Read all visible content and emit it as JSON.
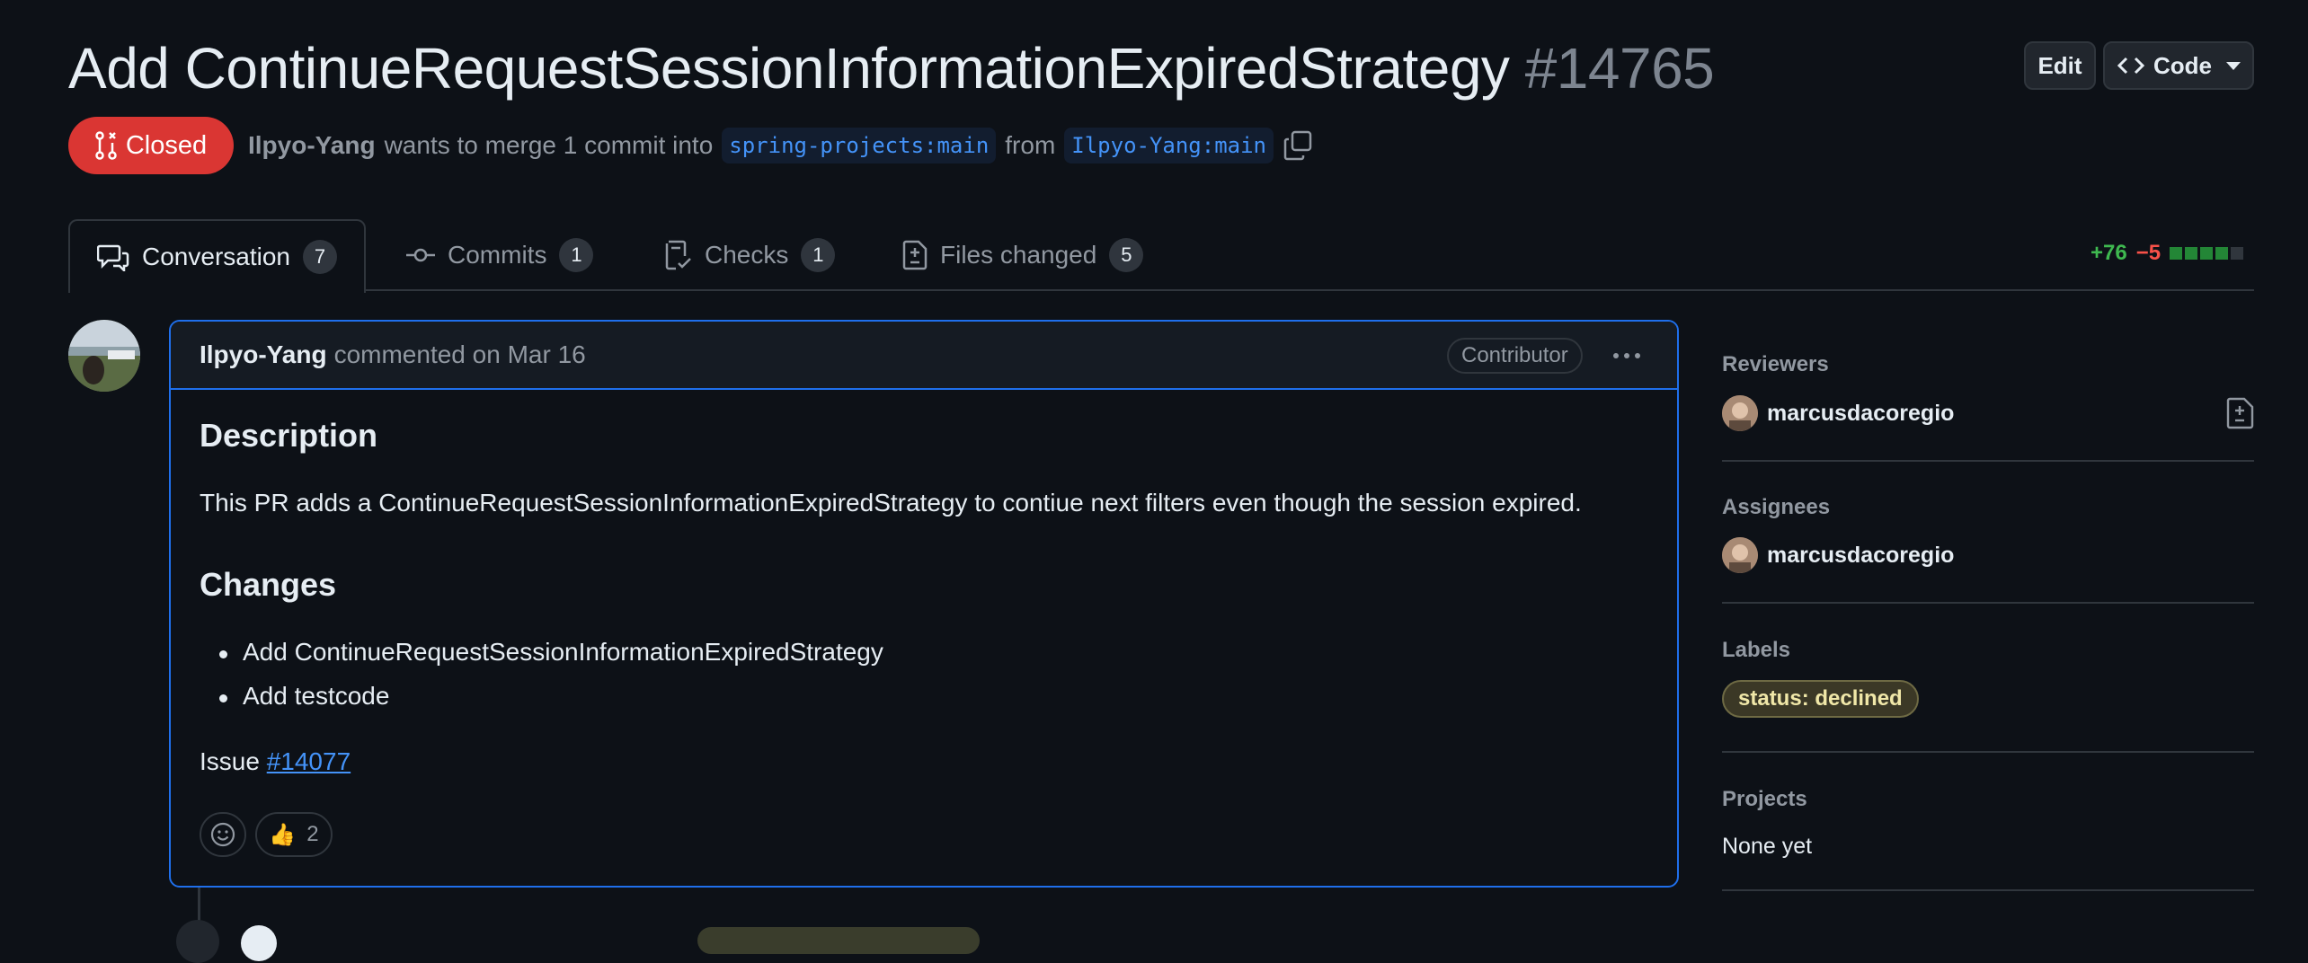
{
  "header": {
    "title": "Add ContinueRequestSessionInformationExpiredStrategy",
    "number": "#14765",
    "edit_label": "Edit",
    "code_label": "Code"
  },
  "status": {
    "state_label": "Closed",
    "author": "Ilpyo-Yang",
    "merge_text": "wants to merge 1 commit into",
    "base_branch": "spring-projects:main",
    "from_text": "from",
    "head_branch": "Ilpyo-Yang:main"
  },
  "tabs": [
    {
      "label": "Conversation",
      "count": "7"
    },
    {
      "label": "Commits",
      "count": "1"
    },
    {
      "label": "Checks",
      "count": "1"
    },
    {
      "label": "Files changed",
      "count": "5"
    }
  ],
  "diffstat": {
    "additions": "+76",
    "deletions": "−5"
  },
  "comment": {
    "author": "Ilpyo-Yang",
    "meta": "commented on Mar 16",
    "role_badge": "Contributor",
    "description_heading": "Description",
    "description_text": "This PR adds a ContinueRequestSessionInformationExpiredStrategy to contiue next filters even though the session expired.",
    "changes_heading": "Changes",
    "changes": [
      "Add ContinueRequestSessionInformationExpiredStrategy",
      "Add testcode"
    ],
    "issue_prefix": "Issue",
    "issue_link": "#14077",
    "reaction_emoji": "👍",
    "reaction_count": "2"
  },
  "sidebar": {
    "reviewers_label": "Reviewers",
    "reviewer": "marcusdacoregio",
    "assignees_label": "Assignees",
    "assignee": "marcusdacoregio",
    "labels_label": "Labels",
    "label": "status: declined",
    "projects_label": "Projects",
    "projects_value": "None yet"
  },
  "colors": {
    "background": "#0d1117",
    "closed": "#da3633",
    "link": "#4493f8",
    "additions": "#3fb950",
    "deletions": "#f85149"
  }
}
